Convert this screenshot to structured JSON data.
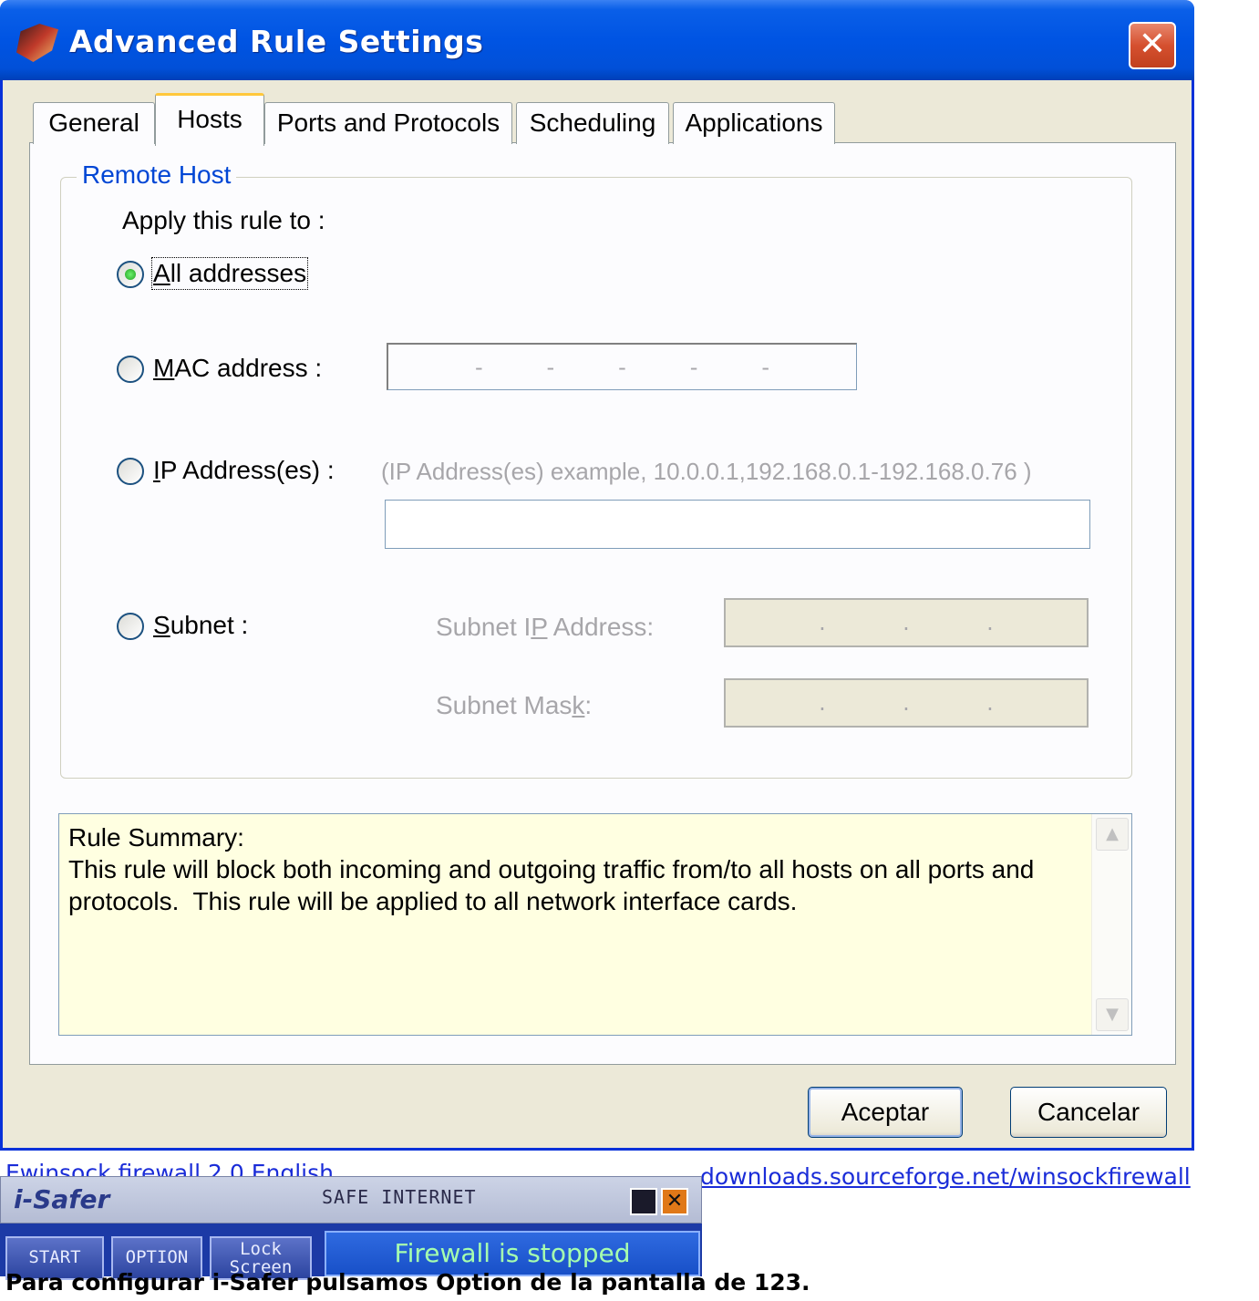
{
  "dialog": {
    "title": "Advanced Rule Settings",
    "close_glyph": "✕"
  },
  "tabs": [
    {
      "label": "General",
      "active": false
    },
    {
      "label": "Hosts",
      "active": true
    },
    {
      "label": "Ports and Protocols",
      "active": false
    },
    {
      "label": "Scheduling",
      "active": false
    },
    {
      "label": "Applications",
      "active": false
    }
  ],
  "remote_host": {
    "group_title": "Remote Host",
    "apply_label": "Apply this rule to :",
    "options": {
      "all": {
        "pre": "",
        "mnemonic": "A",
        "post": "ll addresses",
        "selected": true
      },
      "mac": {
        "pre": "",
        "mnemonic": "M",
        "post": "AC address :",
        "selected": false
      },
      "ip": {
        "pre": "",
        "mnemonic": "I",
        "post": "P Address(es) :",
        "selected": false
      },
      "subnet": {
        "pre": "",
        "mnemonic": "S",
        "post": "ubnet :",
        "selected": false
      }
    },
    "mac_separators": [
      "-",
      "-",
      "-",
      "-",
      "-"
    ],
    "ip_example": "(IP Address(es) example, 10.0.0.1,192.168.0.1-192.168.0.76 )",
    "ip_value": "",
    "subnet_ip_label": {
      "pre": "Subnet I",
      "mnemonic": "P",
      "post": " Address:"
    },
    "subnet_mask_label": {
      "pre": "Subnet Mas",
      "mnemonic": "k",
      "post": ":"
    },
    "subnet_separators": [
      ".",
      ".",
      "."
    ]
  },
  "summary": {
    "text": "Rule Summary:\nThis rule will block both incoming and outgoing traffic from/to all hosts on all ports and\nprotocols.  This rule will be applied to all network interface cards."
  },
  "buttons": {
    "ok": "Aceptar",
    "cancel": "Cancelar"
  },
  "isafer": {
    "logo": "i-Safer",
    "subtitle": "SAFE INTERNET",
    "start": "START",
    "option": "OPTION",
    "lock": "Lock Screen",
    "status": "Firewall is stopped"
  },
  "overlap_text": {
    "line1_a": "Ewinsock firewall 2.0 English",
    "line1_b": "downloads.sourceforge.net/winsockfirewall",
    "line2": "Para configurar i-Safer pulsamos Option de la pantalla de 123."
  }
}
